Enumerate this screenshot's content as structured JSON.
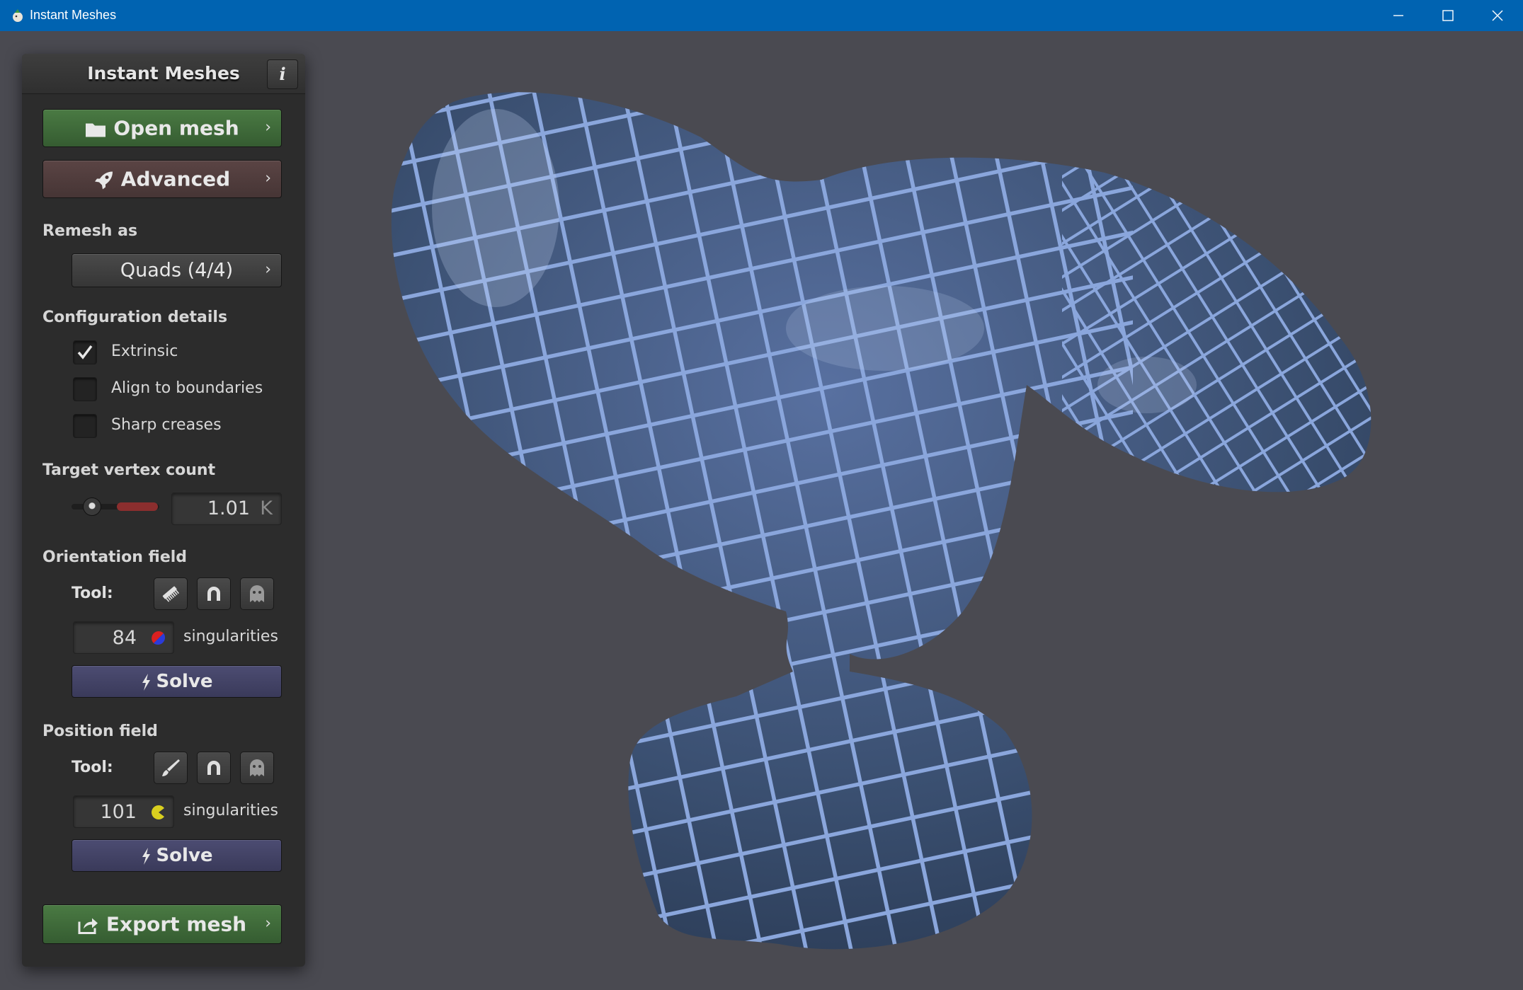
{
  "window": {
    "title": "Instant Meshes",
    "controls": [
      "minimize-icon",
      "maximize-icon",
      "close-icon"
    ]
  },
  "panel": {
    "title": "Instant Meshes",
    "info_label": "i",
    "open_mesh": "Open mesh",
    "advanced": "Advanced",
    "remesh_as_label": "Remesh as",
    "remesh_as_value": "Quads (4/4)",
    "config_label": "Configuration details",
    "checkboxes": [
      {
        "label": "Extrinsic",
        "checked": true
      },
      {
        "label": "Align to boundaries",
        "checked": false
      },
      {
        "label": "Sharp creases",
        "checked": false
      }
    ],
    "target_vertex_label": "Target vertex count",
    "target_vertex_value": "1.01",
    "target_vertex_unit": "K",
    "orientation": {
      "label": "Orientation field",
      "tool_label": "Tool:",
      "tools": [
        "comb-icon",
        "magnet-icon",
        "ghost-icon"
      ],
      "singularities": "84",
      "singularities_label": "singularities",
      "solve": "Solve"
    },
    "position": {
      "label": "Position field",
      "tool_label": "Tool:",
      "tools": [
        "brush-icon",
        "magnet-icon",
        "ghost-icon"
      ],
      "singularities": "101",
      "singularities_label": "singularities",
      "solve": "Solve"
    },
    "export_mesh": "Export mesh"
  },
  "colors": {
    "titlebar": "#0063b1",
    "viewport_bg": "#4a4a51",
    "panel_bg": "#2c2c2c",
    "green_button": "#3f6b3a",
    "advanced_button": "#4f3d3d",
    "solve_button": "#43436a",
    "mesh_fill": "#3f5578",
    "mesh_lines": "#8aa6dc"
  }
}
